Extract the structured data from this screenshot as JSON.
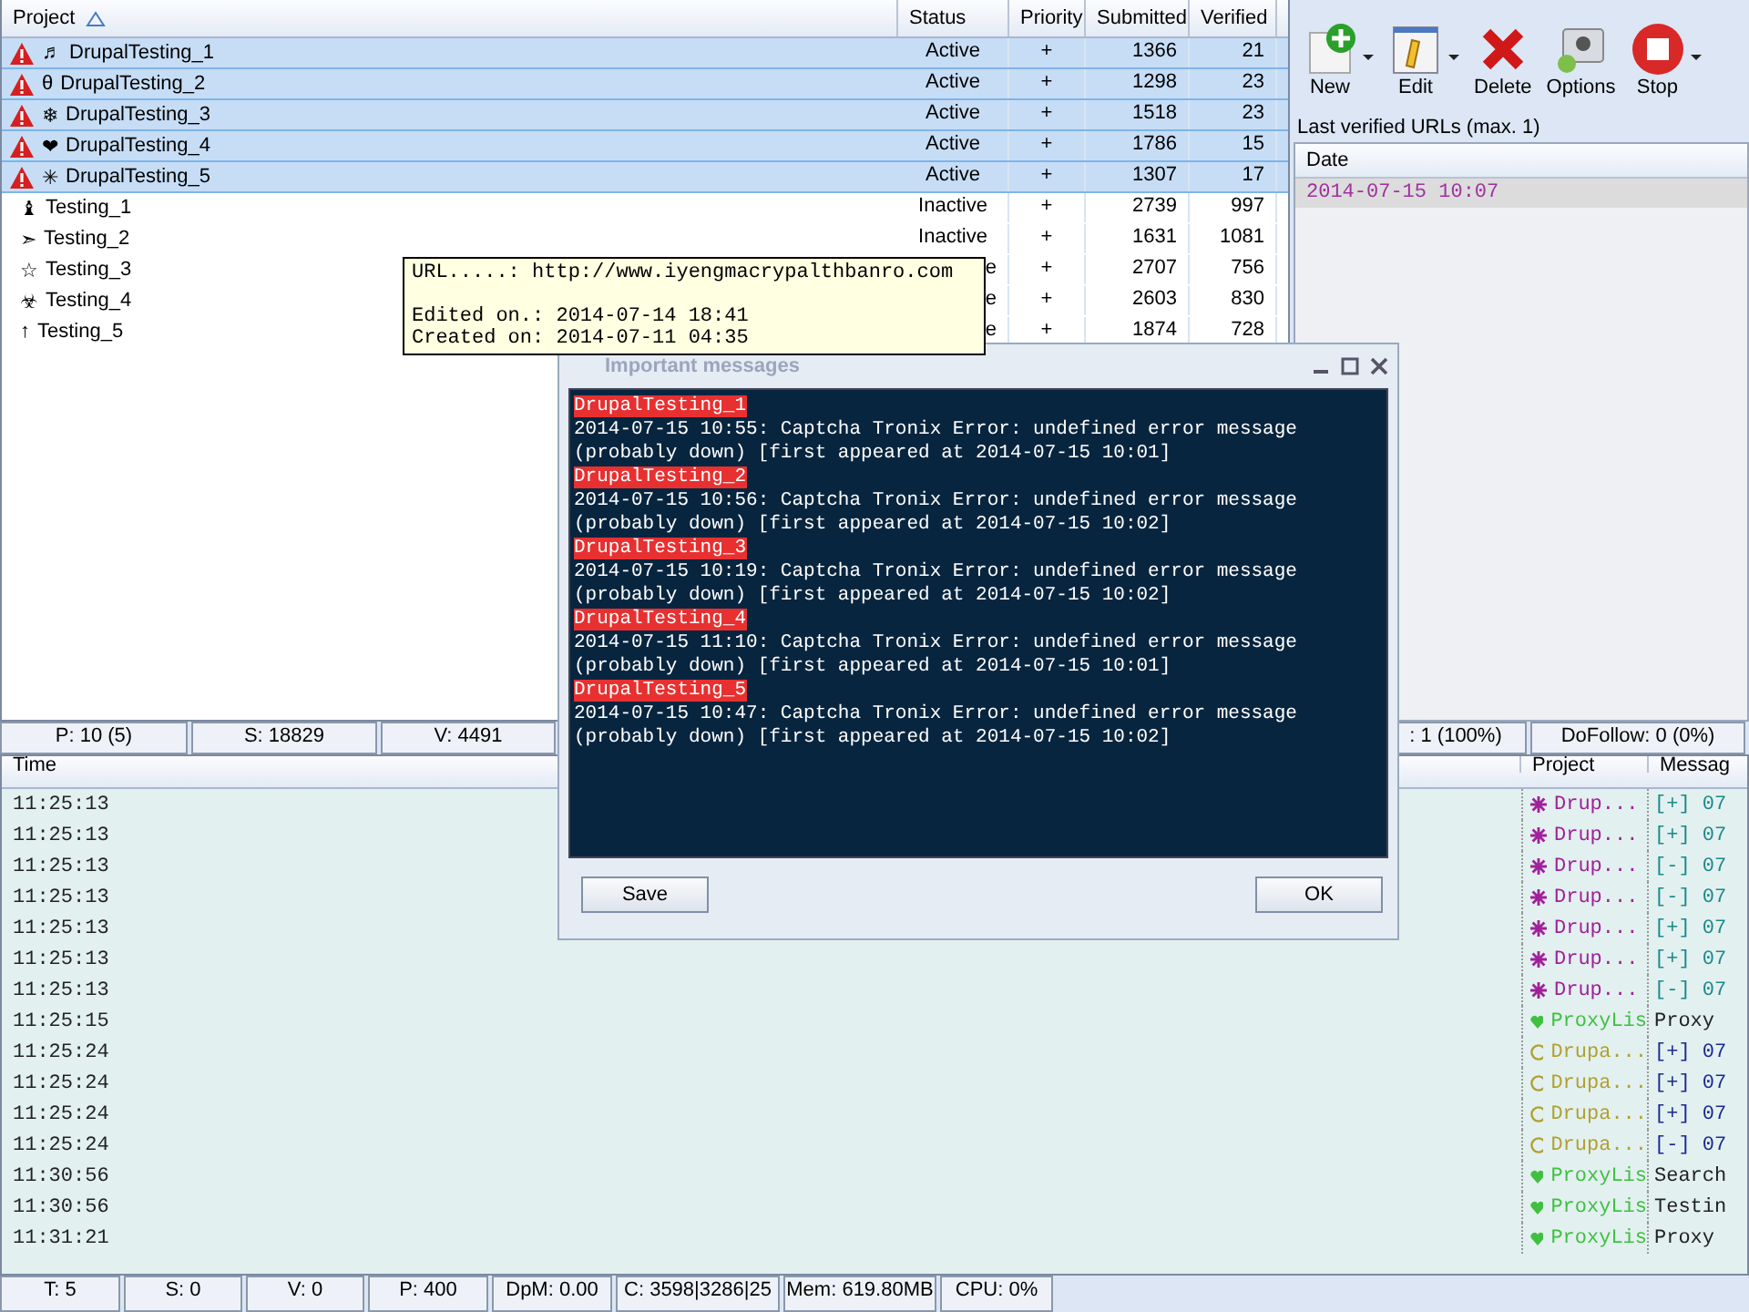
{
  "projects": {
    "columns": [
      "Project",
      "Status",
      "Priority",
      "Submitted",
      "Verified"
    ],
    "rows": [
      {
        "glyph": "♬",
        "name": "DrupalTesting_1",
        "status": "Active",
        "priority": "+",
        "submitted": "1366",
        "verified": "21",
        "selected": true,
        "warning": true
      },
      {
        "glyph": "θ",
        "name": "DrupalTesting_2",
        "status": "Active",
        "priority": "+",
        "submitted": "1298",
        "verified": "23",
        "selected": true,
        "warning": true
      },
      {
        "glyph": "❄",
        "name": "DrupalTesting_3",
        "status": "Active",
        "priority": "+",
        "submitted": "1518",
        "verified": "23",
        "selected": true,
        "warning": true
      },
      {
        "glyph": "❤",
        "name": "DrupalTesting_4",
        "status": "Active",
        "priority": "+",
        "submitted": "1786",
        "verified": "15",
        "selected": true,
        "warning": true
      },
      {
        "glyph": "✳",
        "name": "DrupalTesting_5",
        "status": "Active",
        "priority": "+",
        "submitted": "1307",
        "verified": "17",
        "selected": true,
        "warning": true
      },
      {
        "glyph": "♝",
        "name": "Testing_1",
        "status": "Inactive",
        "priority": "+",
        "submitted": "2739",
        "verified": "997",
        "selected": false,
        "warning": false
      },
      {
        "glyph": "➣",
        "name": "Testing_2",
        "status": "Inactive",
        "priority": "+",
        "submitted": "1631",
        "verified": "1081",
        "selected": false,
        "warning": false
      },
      {
        "glyph": "☆",
        "name": "Testing_3",
        "status": "e",
        "priority": "+",
        "submitted": "2707",
        "verified": "756",
        "selected": false,
        "warning": false
      },
      {
        "glyph": "☣",
        "name": "Testing_4",
        "status": "e",
        "priority": "+",
        "submitted": "2603",
        "verified": "830",
        "selected": false,
        "warning": false
      },
      {
        "glyph": "↑",
        "name": "Testing_5",
        "status": "e",
        "priority": "+",
        "submitted": "1874",
        "verified": "728",
        "selected": false,
        "warning": false
      }
    ]
  },
  "tooltip": {
    "lines": [
      "URL.....: http://www.iyengmacrypalthbanro.com",
      "Edited on.: 2014-07-14 18:41",
      "Created on: 2014-07-11 04:35"
    ]
  },
  "toolbar": [
    {
      "kind": "new",
      "label": "New",
      "dropdown": true
    },
    {
      "kind": "edit",
      "label": "Edit",
      "dropdown": true
    },
    {
      "kind": "delete",
      "label": "Delete",
      "dropdown": false
    },
    {
      "kind": "options",
      "label": "Options",
      "dropdown": false
    },
    {
      "kind": "stop",
      "label": "Stop",
      "dropdown": true
    }
  ],
  "verified_urls": {
    "title": "Last verified URLs (max. 1)",
    "column": "Date",
    "rows": [
      "2014-07-15 10:07"
    ]
  },
  "status_top": {
    "left": [
      "P: 10 (5)",
      "S: 18829",
      "V: 4491"
    ],
    "right": [
      ": 1 (100%)",
      "DoFollow: 0 (0%)"
    ]
  },
  "log": {
    "columns": [
      "Time",
      "Project",
      "Messag"
    ],
    "rows": [
      {
        "time": "11:25:13",
        "kind": "sun",
        "project": "Drup...",
        "color": "#a0209a",
        "message": "[+] 07"
      },
      {
        "time": "11:25:13",
        "kind": "sun",
        "project": "Drup...",
        "color": "#a0209a",
        "message": "[+] 07"
      },
      {
        "time": "11:25:13",
        "kind": "sun",
        "project": "Drup...",
        "color": "#a0209a",
        "message": "[-] 07"
      },
      {
        "time": "11:25:13",
        "kind": "sun",
        "project": "Drup...",
        "color": "#a0209a",
        "message": "[-] 07"
      },
      {
        "time": "11:25:13",
        "kind": "sun",
        "project": "Drup...",
        "color": "#a0209a",
        "message": "[+] 07"
      },
      {
        "time": "11:25:13",
        "kind": "sun",
        "project": "Drup...",
        "color": "#a0209a",
        "message": "[+] 07"
      },
      {
        "time": "11:25:13",
        "kind": "sun",
        "project": "Drup...",
        "color": "#a0209a",
        "message": "[-] 07"
      },
      {
        "time": "11:25:15",
        "kind": "heart",
        "project": "ProxyLis",
        "color": "#40c040",
        "message": "Proxy"
      },
      {
        "time": "11:25:24",
        "kind": "smile",
        "project": "Drupa...",
        "color": "#b0a030",
        "message": "[+] 07"
      },
      {
        "time": "11:25:24",
        "kind": "smile",
        "project": "Drupa...",
        "color": "#b0a030",
        "message": "[+] 07"
      },
      {
        "time": "11:25:24",
        "kind": "smile",
        "project": "Drupa...",
        "color": "#b0a030",
        "message": "[+] 07"
      },
      {
        "time": "11:25:24",
        "kind": "smile",
        "project": "Drupa...",
        "color": "#b0a030",
        "message": "[-] 07"
      },
      {
        "time": "11:30:56",
        "kind": "heart",
        "project": "ProxyLis",
        "color": "#40c040",
        "message": "Search"
      },
      {
        "time": "11:30:56",
        "kind": "heart",
        "project": "ProxyLis",
        "color": "#40c040",
        "message": "Testin"
      },
      {
        "time": "11:31:21",
        "kind": "heart",
        "project": "ProxyLis",
        "color": "#40c040",
        "message": "Proxy"
      }
    ]
  },
  "status_bottom": [
    "T: 5",
    "S: 0",
    "V: 0",
    "P: 400",
    "DpM: 0.00",
    "C: 3598|3286|25",
    "Mem: 619.80MB",
    "CPU: 0%"
  ],
  "dialog": {
    "title": "Important messages",
    "messages": [
      {
        "project": "DrupalTesting_1",
        "text": "2014-07-15 10:55: Captcha Tronix Error: undefined error message (probably down) [first appeared at 2014-07-15 10:01]"
      },
      {
        "project": "DrupalTesting_2",
        "text": "2014-07-15 10:56: Captcha Tronix Error: undefined error message (probably down) [first appeared at 2014-07-15 10:02]"
      },
      {
        "project": "DrupalTesting_3",
        "text": "2014-07-15 10:19: Captcha Tronix Error: undefined error message (probably down) [first appeared at 2014-07-15 10:02]"
      },
      {
        "project": "DrupalTesting_4",
        "text": "2014-07-15 11:10: Captcha Tronix Error: undefined error message (probably down) [first appeared at 2014-07-15 10:01]"
      },
      {
        "project": "DrupalTesting_5",
        "text": "2014-07-15 10:47: Captcha Tronix Error: undefined error message (probably down) [first appeared at 2014-07-15 10:02]"
      }
    ],
    "buttons": [
      "Save",
      "OK"
    ]
  }
}
